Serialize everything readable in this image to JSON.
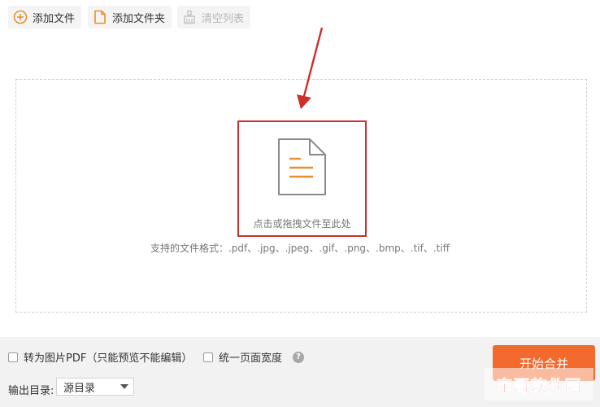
{
  "toolbar": {
    "add_file_label": "添加文件",
    "add_folder_label": "添加文件夹",
    "clear_list_label": "清空列表"
  },
  "drop_zone": {
    "hint": "点击或拖拽文件至此处",
    "formats": "支持的文件格式：.pdf、.jpg、.jpeg、.gif、.png、.bmp、.tif、.tiff"
  },
  "options": {
    "convert_to_image_pdf": "转为图片PDF（只能预览不能编辑）",
    "unify_page_width": "统一页面宽度",
    "help_icon": "?"
  },
  "output": {
    "label": "输出目录:",
    "selected": "源目录"
  },
  "start_button": "开始合并",
  "watermark": "宝哥软件园",
  "colors": {
    "accent": "#f36a2e",
    "highlight_border": "#c9302c",
    "icon_orange": "#e8902e"
  }
}
